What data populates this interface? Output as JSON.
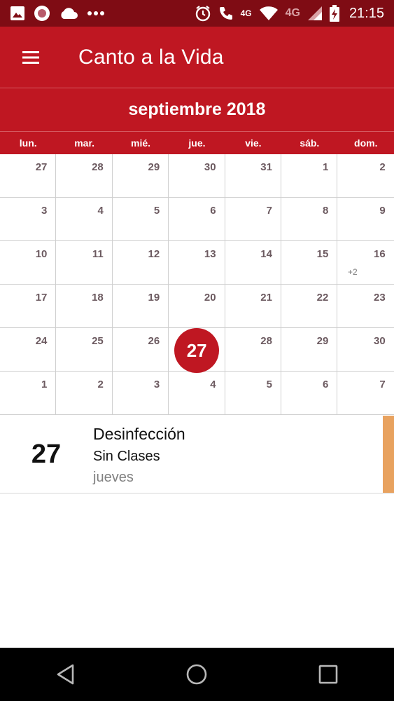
{
  "status_bar": {
    "time": "21:15",
    "network_label": "4G",
    "network_label_secondary": "4G",
    "icons_left": [
      "image-icon",
      "record-icon",
      "cloud-icon",
      "more-notifications-icon"
    ],
    "icons_right": [
      "alarm-icon",
      "wifi-call-icon",
      "wifi-icon",
      "signal-icon",
      "battery-charging-icon"
    ]
  },
  "app_bar": {
    "title": "Canto a la Vida",
    "menu_icon": "hamburger-menu-icon"
  },
  "calendar": {
    "month_title": "septiembre 2018",
    "weekdays": [
      "lun.",
      "mar.",
      "mié.",
      "jue.",
      "vie.",
      "sáb.",
      "dom."
    ],
    "weeks": [
      [
        "27",
        "28",
        "29",
        "30",
        "31",
        "1",
        "2"
      ],
      [
        "3",
        "4",
        "5",
        "6",
        "7",
        "8",
        "9"
      ],
      [
        "10",
        "11",
        "12",
        "13",
        "14",
        "15",
        "16"
      ],
      [
        "17",
        "18",
        "19",
        "20",
        "21",
        "22",
        "23"
      ],
      [
        "24",
        "25",
        "26",
        "27",
        "28",
        "29",
        "30"
      ],
      [
        "1",
        "2",
        "3",
        "4",
        "5",
        "6",
        "7"
      ]
    ],
    "today": "27",
    "more_events_label": "+2"
  },
  "event": {
    "day": "27",
    "title": "Desinfección",
    "subtitle": "Sin Clases",
    "weekday": "jueves",
    "stripe_color": "#e8a25f"
  },
  "colors": {
    "primary": "#bf1722",
    "status_bar": "#7f0c14"
  },
  "nav_bar": {
    "buttons": [
      "back-icon",
      "home-icon",
      "recents-icon"
    ]
  }
}
